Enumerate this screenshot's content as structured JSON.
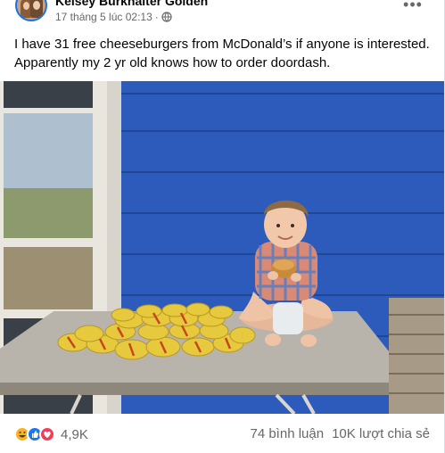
{
  "post": {
    "author": "Kelsey Burkhalter Golden",
    "timestamp": "17 tháng 5 lúc 02:13",
    "separator": "·",
    "privacy_icon": "globe-icon",
    "more_label": "•••",
    "text": "I have 31 free cheeseburgers from McDonald’s if anyone is interested. Apparently my 2 yr old knows how to order doordash."
  },
  "reactions": {
    "icons": [
      "haha-icon",
      "like-icon",
      "love-icon"
    ],
    "count": "4,9K",
    "comments": "74 bình luận",
    "shares": "10K lượt chia sẻ"
  },
  "colors": {
    "accent": "#1877f2",
    "secondary_text": "#65676b",
    "wall_blue": "#2a57b6"
  }
}
